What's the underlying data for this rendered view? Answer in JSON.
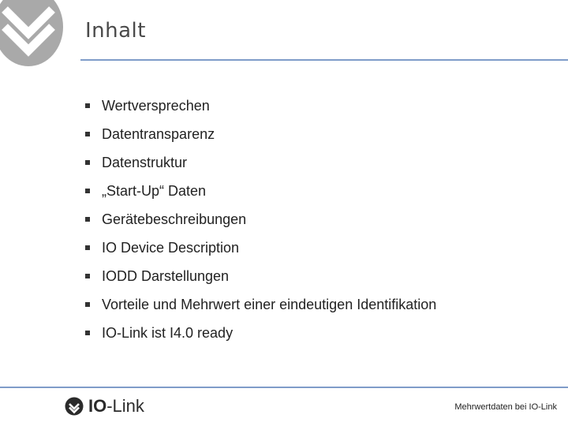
{
  "slide": {
    "title": "Inhalt",
    "items": [
      "Wertversprechen",
      "Datentransparenz",
      "Datenstruktur",
      "„Start-Up“ Daten",
      "Gerätebeschreibungen",
      "IO Device Description",
      "IODD Darstellungen",
      "Vorteile und Mehrwert einer eindeutigen Identifikation",
      "IO-Link ist I4.0 ready"
    ]
  },
  "footer": {
    "brand_bold": "IO",
    "brand_light": "-Link",
    "caption": "Mehrwertdaten bei IO-Link"
  },
  "colors": {
    "rule": "#7f9cc9",
    "logo_gray": "#a9a9a9",
    "text": "#222222"
  }
}
